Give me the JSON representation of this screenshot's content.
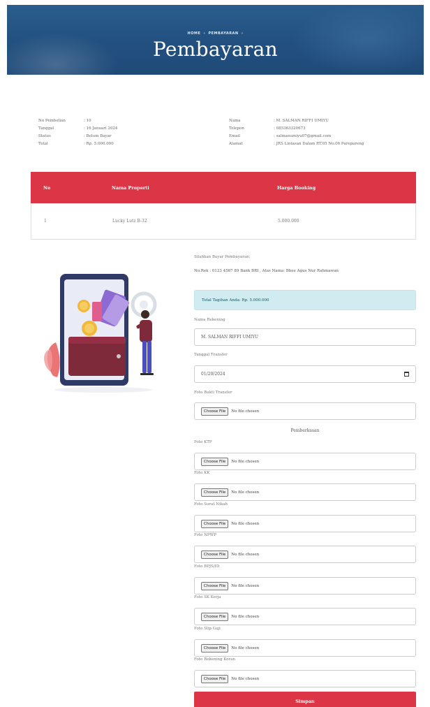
{
  "hero": {
    "breadcrumb": [
      "HOME",
      "PEMBAYARAN"
    ],
    "title": "Pembayaran"
  },
  "info_left": [
    {
      "key": "No Pembelian",
      "value": ": 10"
    },
    {
      "key": "Tanggal",
      "value": ": 16 Januari 2024"
    },
    {
      "key": "Status",
      "value": ": Belum Bayar"
    },
    {
      "key": "Total",
      "value": ": Rp. 5.000.000"
    }
  ],
  "info_right": [
    {
      "key": "Nama",
      "value": ": M. SALMAN RIFFI UMIYU"
    },
    {
      "key": "Telepon",
      "value": ": 085363320673"
    },
    {
      "key": "Email",
      "value": ": salmanumiyu07@gmail.com"
    },
    {
      "key": "Alamat",
      "value": ": JRS Lintasan Dalam RT.05 No.06 Parepareng"
    }
  ],
  "table": {
    "headers": [
      "No",
      "Nama Properti",
      "Harga Booking"
    ],
    "rows": [
      {
        "no": "1",
        "name": "Lucky Lutz B-32",
        "price": "5.000.000"
      }
    ]
  },
  "form": {
    "info_label": "Silahkan Bayar Pembayaran:",
    "rekening": "No.Rek : 0123 4567 89 Bank BRI , Atas Nama: Bhee Agus Nur Rahmawan",
    "alert_text": "Total Tagihan Anda: Rp. 5.000.000",
    "fields": {
      "nama_label": "Nama Rekening",
      "nama_value": "M. SALMAN RIFFI UMIYU",
      "tanggal_label": "Tanggal Transfer",
      "tanggal_value": "01/20/2024",
      "bukti_label": "Foto Bukti Transfer"
    },
    "section_title": "Pemberkasan",
    "choose_file_label": "Choose File",
    "no_file_label": "No file chosen",
    "berkas": [
      {
        "label": "Foto KTP"
      },
      {
        "label": "Foto KK"
      },
      {
        "label": "Foto Surat Nikah"
      },
      {
        "label": "Foto NPWP"
      },
      {
        "label": "Foto BPJS/ID"
      },
      {
        "label": "Foto SK Kerja"
      },
      {
        "label": "Foto Slip Gaji"
      },
      {
        "label": "Foto Rekening Koran"
      }
    ],
    "submit_label": "Simpan"
  },
  "colors": {
    "hero_bg": "#22507f",
    "table_header": "#dc3545",
    "submit_bg": "#dc3545",
    "alert_bg": "#d1ecf1"
  }
}
